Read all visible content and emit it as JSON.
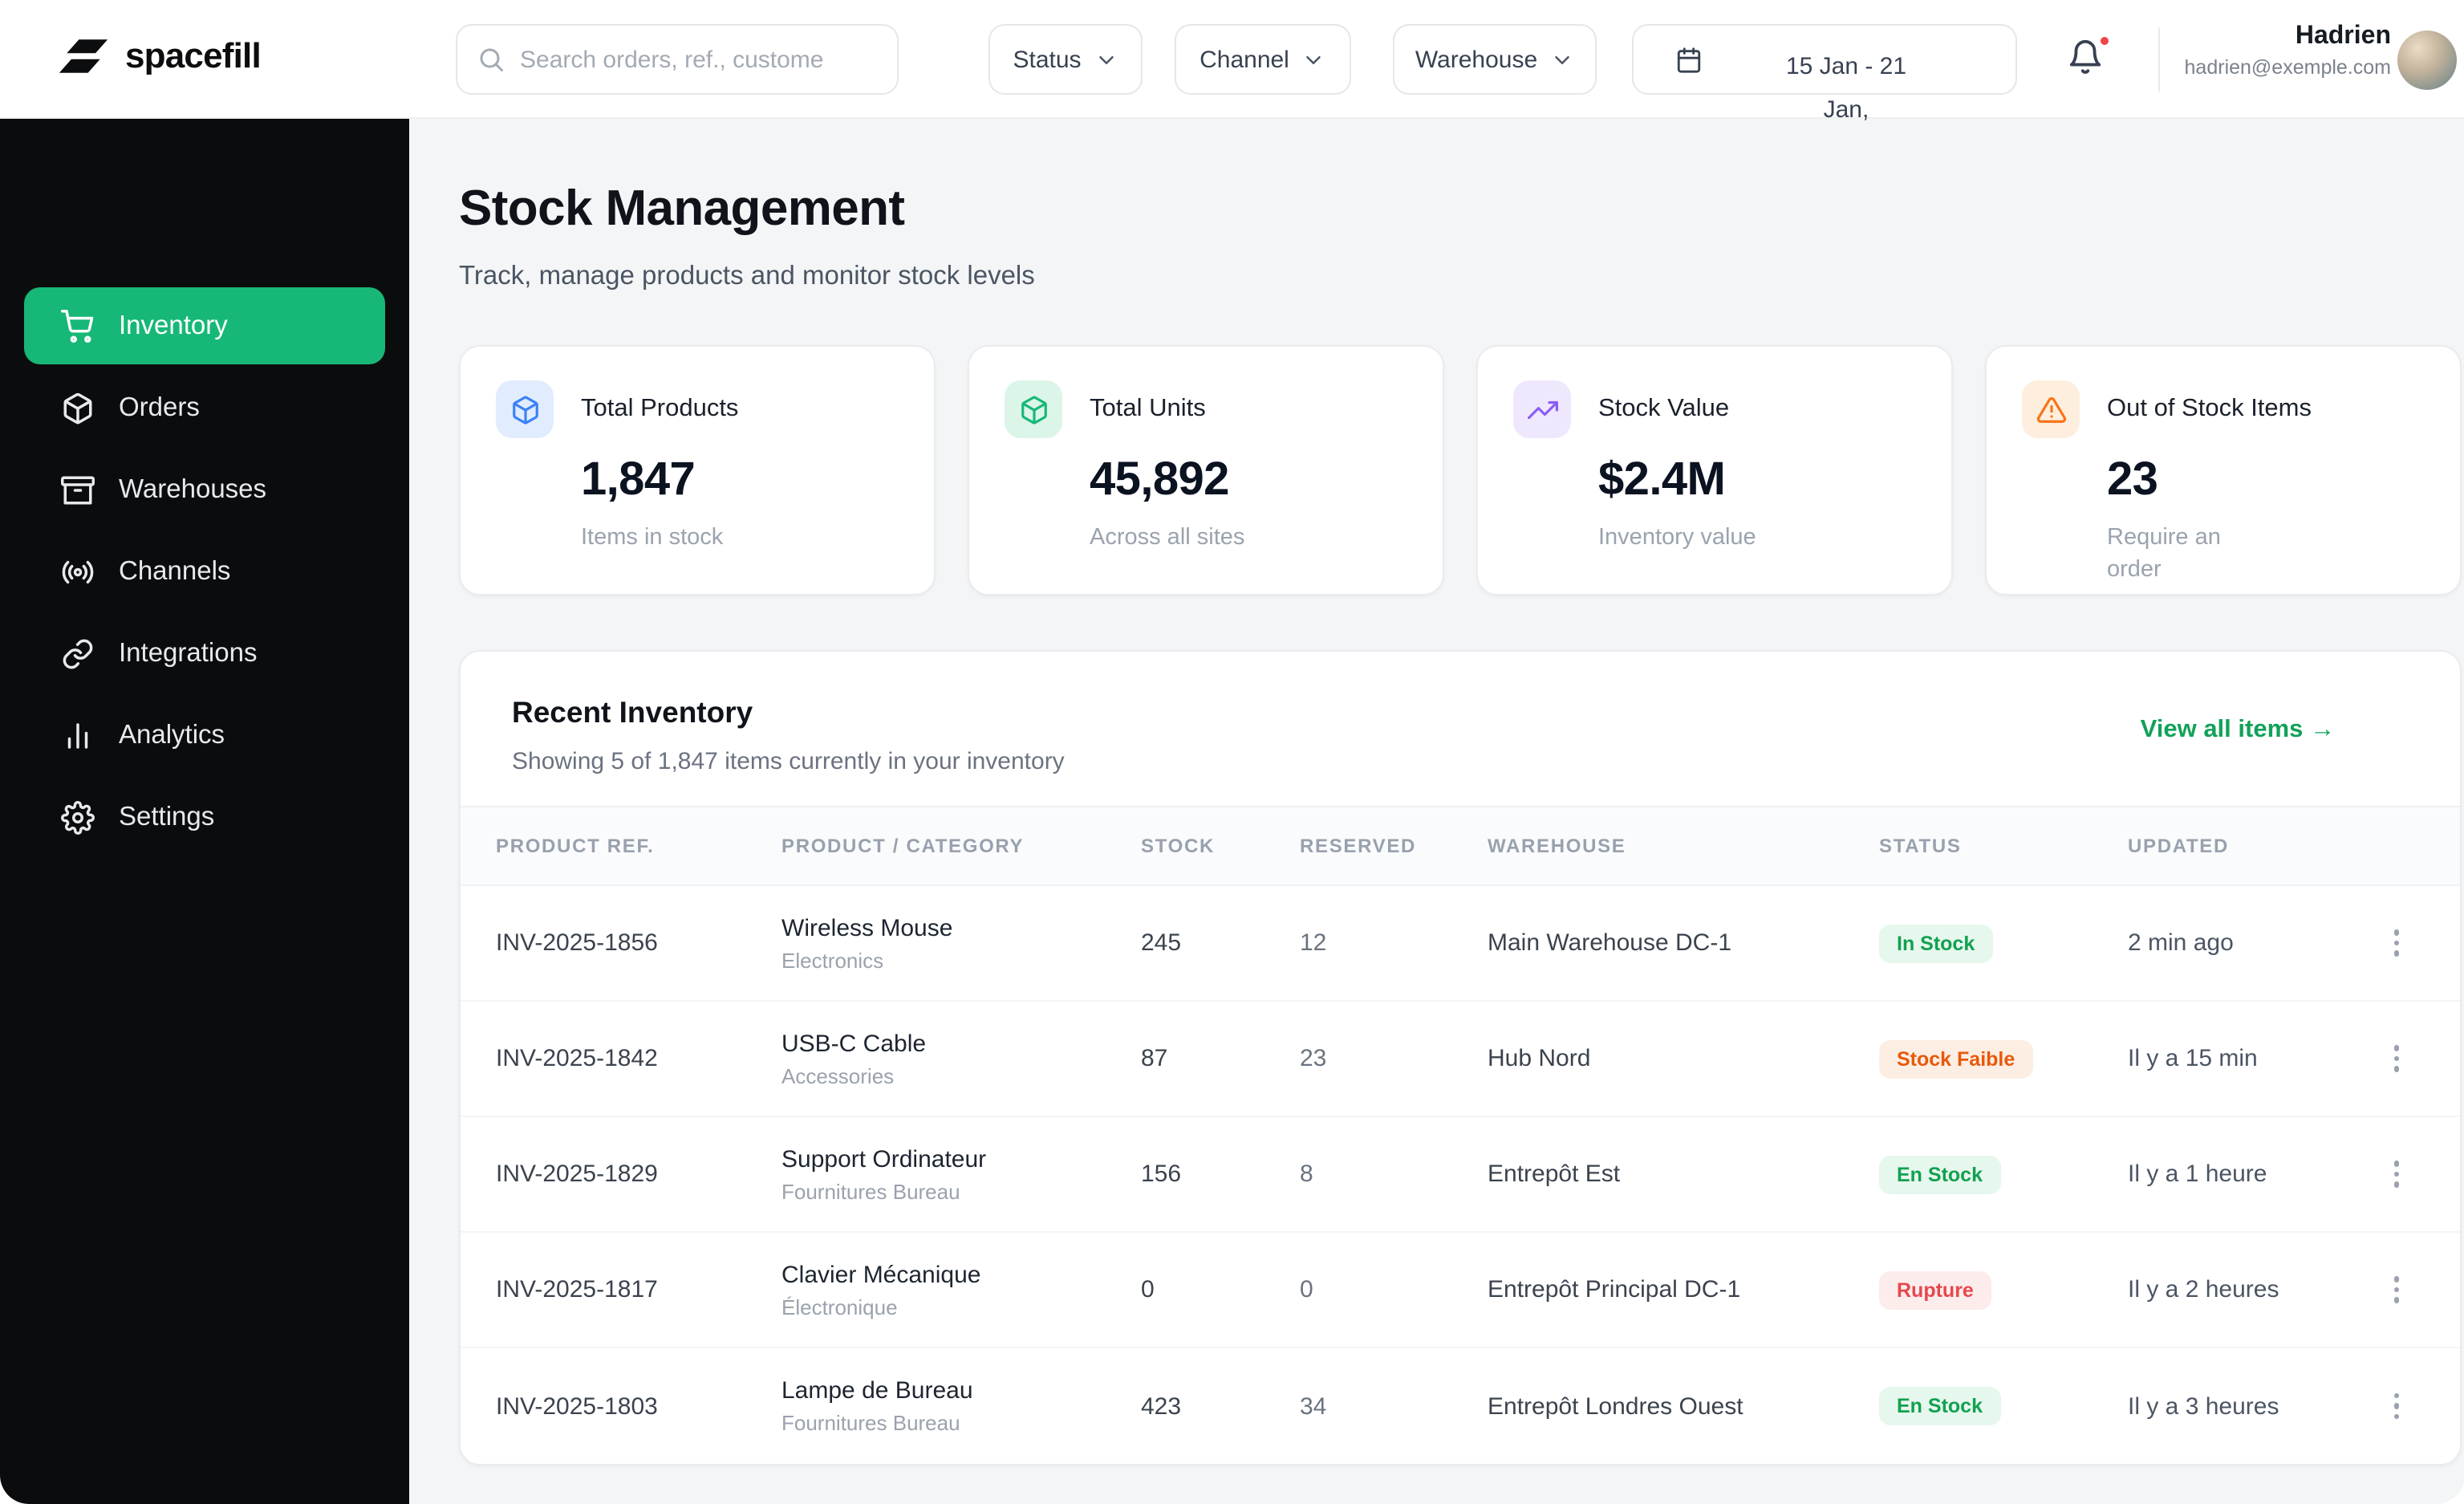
{
  "colors": {
    "accent_green": "#17b877",
    "link_green": "#12a159",
    "sidebar_bg": "#0b0c0e",
    "status_in_stock_text": "#12a150",
    "status_low_stock_text": "#e8590c",
    "status_out_of_stock_text": "#e5484d",
    "stat_icon_blue": "#3b82f6",
    "stat_icon_green": "#17b877",
    "stat_icon_purple": "#8b5cf6",
    "stat_icon_orange": "#f97316"
  },
  "brand": {
    "name": "spacefill",
    "logo_icon": "spacefill-logo-icon"
  },
  "topbar": {
    "search": {
      "placeholder": "Search orders, ref., custome",
      "icon": "search-icon"
    },
    "filters": [
      {
        "label": "Status",
        "icon": "chevron-down-icon"
      },
      {
        "label": "Channel",
        "icon": "chevron-down-icon"
      },
      {
        "label": "Warehouse",
        "icon": "chevron-down-icon"
      }
    ],
    "date_range": {
      "label": "15 Jan - 21 Jan,",
      "icon": "calendar-icon"
    },
    "notifications": {
      "icon": "bell-icon",
      "has_unread": true
    },
    "user": {
      "name": "Hadrien",
      "email": "hadrien@exemple.com"
    }
  },
  "sidebar": {
    "items": [
      {
        "label": "Inventory",
        "icon": "cart-icon",
        "active": true
      },
      {
        "label": "Orders",
        "icon": "box-icon",
        "active": false
      },
      {
        "label": "Warehouses",
        "icon": "archive-icon",
        "active": false
      },
      {
        "label": "Channels",
        "icon": "broadcast-icon",
        "active": false
      },
      {
        "label": "Integrations",
        "icon": "link-icon",
        "active": false
      },
      {
        "label": "Analytics",
        "icon": "bar-chart-icon",
        "active": false
      },
      {
        "label": "Settings",
        "icon": "gear-icon",
        "active": false
      }
    ]
  },
  "page": {
    "title": "Stock Management",
    "subtitle": "Track, manage products and monitor stock levels"
  },
  "stats": [
    {
      "label": "Total Products",
      "value": "1,847",
      "caption": "Items in stock",
      "icon": "package-icon",
      "icon_color": "#3b82f6",
      "icon_bg": "#e1ecfe"
    },
    {
      "label": "Total Units",
      "value": "45,892",
      "caption": "Across all sites",
      "icon": "package-icon",
      "icon_color": "#17b877",
      "icon_bg": "#dcf5e9"
    },
    {
      "label": "Stock Value",
      "value": "$2.4M",
      "caption": "Inventory value",
      "icon": "trending-up-icon",
      "icon_color": "#8b5cf6",
      "icon_bg": "#efe8fd"
    },
    {
      "label": "Out of Stock Items",
      "value": "23",
      "caption": "Require an order",
      "icon": "alert-triangle-icon",
      "icon_color": "#f97316",
      "icon_bg": "#fdeedd"
    }
  ],
  "inventory": {
    "title": "Recent Inventory",
    "subtitle": "Showing 5 of 1,847 items currently in your inventory",
    "view_all": "View all items →",
    "columns": [
      "PRODUCT REF.",
      "PRODUCT / CATEGORY",
      "STOCK",
      "RESERVED",
      "WAREHOUSE",
      "STATUS",
      "UPDATED"
    ],
    "rows": [
      {
        "ref": "INV-2025-1856",
        "product": "Wireless Mouse",
        "category": "Electronics",
        "stock": "245",
        "reserved": "12",
        "warehouse": "Main Warehouse DC-1",
        "status": "In Stock",
        "status_type": "success",
        "updated": "2 min ago"
      },
      {
        "ref": "INV-2025-1842",
        "product": "USB-C Cable",
        "category": "Accessories",
        "stock": "87",
        "reserved": "23",
        "warehouse": "Hub Nord",
        "status": "Stock Faible",
        "status_type": "warning",
        "updated": "Il y a 15 min"
      },
      {
        "ref": "INV-2025-1829",
        "product": "Support Ordinateur",
        "category": "Fournitures Bureau",
        "stock": "156",
        "reserved": "8",
        "warehouse": "Entrepôt Est",
        "status": "En Stock",
        "status_type": "success",
        "updated": "Il y a 1 heure"
      },
      {
        "ref": "INV-2025-1817",
        "product": "Clavier Mécanique",
        "category": "Électronique",
        "stock": "0",
        "reserved": "0",
        "warehouse": "Entrepôt Principal DC-1",
        "status": "Rupture",
        "status_type": "danger",
        "updated": "Il y a 2 heures"
      },
      {
        "ref": "INV-2025-1803",
        "product": "Lampe de Bureau",
        "category": "Fournitures Bureau",
        "stock": "423",
        "reserved": "34",
        "warehouse": "Entrepôt Londres Ouest",
        "status": "En Stock",
        "status_type": "success",
        "updated": "Il y a 3 heures"
      }
    ]
  }
}
